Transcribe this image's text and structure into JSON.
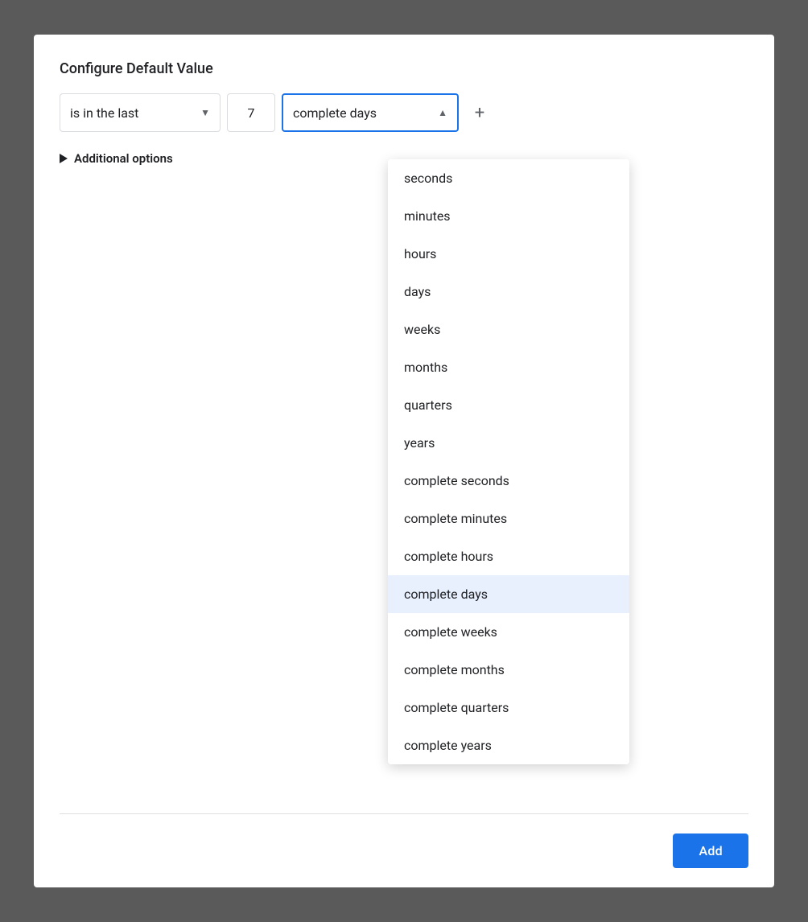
{
  "dialog": {
    "title": "Configure Default Value"
  },
  "controls": {
    "condition_label": "is in the last",
    "condition_arrow": "▼",
    "number_value": "7",
    "unit_selected": "complete days",
    "unit_arrow": "▲",
    "plus_label": "+",
    "additional_options_label": "Additional options"
  },
  "dropdown": {
    "items": [
      {
        "id": "seconds",
        "label": "seconds",
        "selected": false
      },
      {
        "id": "minutes",
        "label": "minutes",
        "selected": false
      },
      {
        "id": "hours",
        "label": "hours",
        "selected": false
      },
      {
        "id": "days",
        "label": "days",
        "selected": false
      },
      {
        "id": "weeks",
        "label": "weeks",
        "selected": false
      },
      {
        "id": "months",
        "label": "months",
        "selected": false
      },
      {
        "id": "quarters",
        "label": "quarters",
        "selected": false
      },
      {
        "id": "years",
        "label": "years",
        "selected": false
      },
      {
        "id": "complete-seconds",
        "label": "complete seconds",
        "selected": false
      },
      {
        "id": "complete-minutes",
        "label": "complete minutes",
        "selected": false
      },
      {
        "id": "complete-hours",
        "label": "complete hours",
        "selected": false
      },
      {
        "id": "complete-days",
        "label": "complete days",
        "selected": true
      },
      {
        "id": "complete-weeks",
        "label": "complete weeks",
        "selected": false
      },
      {
        "id": "complete-months",
        "label": "complete months",
        "selected": false
      },
      {
        "id": "complete-quarters",
        "label": "complete quarters",
        "selected": false
      },
      {
        "id": "complete-years",
        "label": "complete years",
        "selected": false
      }
    ]
  },
  "footer": {
    "add_button_label": "Add"
  }
}
